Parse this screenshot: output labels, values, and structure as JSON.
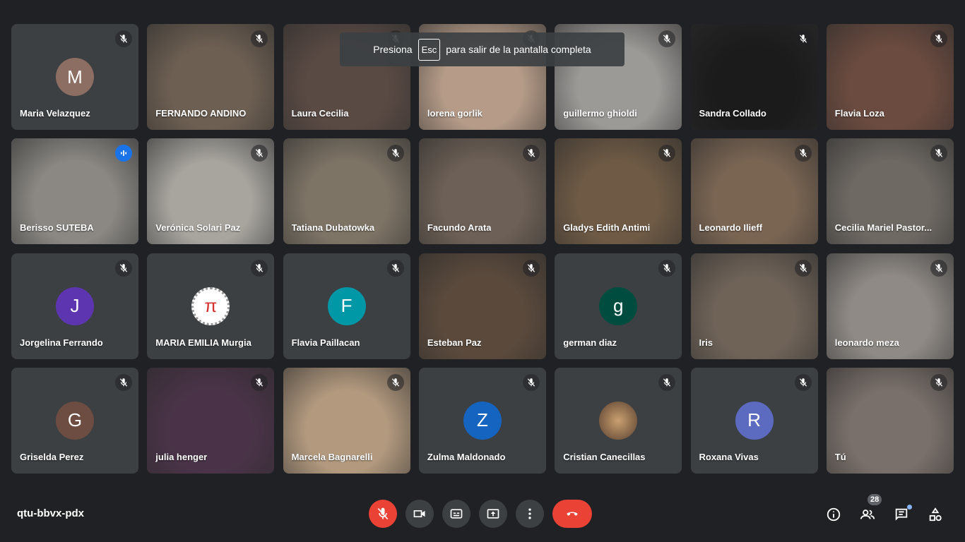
{
  "toast": {
    "before": "Presiona",
    "key": "Esc",
    "after": "para salir de la pantalla completa"
  },
  "meeting_code": "qtu-bbvx-pdx",
  "participants_count": "28",
  "participants": [
    {
      "name": "Maria Velazquez",
      "initial": "M",
      "avatar_color": "#8d6e63",
      "kind": "avatar"
    },
    {
      "name": "FERNANDO ANDINO",
      "kind": "video",
      "bg": "#6d5f52"
    },
    {
      "name": "Laura Cecilia",
      "kind": "video",
      "bg": "#5a4a44"
    },
    {
      "name": "lorena gorlik",
      "kind": "video",
      "bg": "#b59b88"
    },
    {
      "name": "guillermo ghioldi",
      "kind": "video",
      "bg": "#9c9a97"
    },
    {
      "name": "Sandra Collado",
      "kind": "video",
      "bg": "#1b1b1b"
    },
    {
      "name": "Flavia Loza",
      "kind": "video",
      "bg": "#6b4b3f"
    },
    {
      "name": "Berisso SUTEBA",
      "kind": "video",
      "bg": "#8b8883",
      "speaking": true
    },
    {
      "name": "Verónica Solari Paz",
      "kind": "video",
      "bg": "#a8a59f"
    },
    {
      "name": "Tatiana Dubatowka",
      "kind": "video",
      "bg": "#7e7466"
    },
    {
      "name": "Facundo Arata",
      "kind": "video",
      "bg": "#6d6056"
    },
    {
      "name": "Gladys Edith Antimi",
      "kind": "video",
      "bg": "#6e5a45"
    },
    {
      "name": "Leonardo Ilieff",
      "kind": "video",
      "bg": "#7a6553"
    },
    {
      "name": "Cecilia Mariel Pastor...",
      "kind": "video",
      "bg": "#6e6963"
    },
    {
      "name": "Jorgelina Ferrando",
      "initial": "J",
      "avatar_color": "#5e35b1",
      "kind": "avatar"
    },
    {
      "name": "MARIA EMILIA Murgia",
      "initial": "π",
      "avatar_color": "#ffffff",
      "kind": "avatar",
      "pi": true
    },
    {
      "name": "Flavia Paillacan",
      "initial": "F",
      "avatar_color": "#0097a7",
      "kind": "avatar"
    },
    {
      "name": "Esteban Paz",
      "kind": "video",
      "bg": "#5b4a3c"
    },
    {
      "name": "german diaz",
      "initial": "g",
      "avatar_color": "#004d40",
      "kind": "avatar"
    },
    {
      "name": "Iris",
      "kind": "video",
      "bg": "#6f6358"
    },
    {
      "name": "leonardo meza",
      "kind": "video",
      "bg": "#8f8a85"
    },
    {
      "name": "Griselda Perez",
      "initial": "G",
      "avatar_color": "#6d4c41",
      "kind": "avatar"
    },
    {
      "name": "julia henger",
      "kind": "video",
      "bg": "#4a3348"
    },
    {
      "name": "Marcela Bagnarelli",
      "kind": "video",
      "bg": "#b39a7f"
    },
    {
      "name": "Zulma Maldonado",
      "initial": "Z",
      "avatar_color": "#1565c0",
      "kind": "avatar"
    },
    {
      "name": "Cristian Canecillas",
      "initial": "",
      "avatar_color": "#8a6a4a",
      "kind": "avatar"
    },
    {
      "name": "Roxana Vivas",
      "initial": "R",
      "avatar_color": "#5c6bc0",
      "kind": "avatar"
    },
    {
      "name": "Tú",
      "kind": "video",
      "bg": "#7a706b"
    }
  ],
  "colors": {
    "background": "#202124",
    "tile": "#3c4043",
    "end_call": "#ea4335",
    "speaking": "#1a73e8"
  },
  "controls": [
    "mic-off-icon",
    "videocam-icon",
    "captions-icon",
    "present-icon",
    "more-vert-icon",
    "call-end-icon"
  ],
  "right_controls": [
    "info-icon",
    "people-icon",
    "chat-icon",
    "activities-icon"
  ]
}
